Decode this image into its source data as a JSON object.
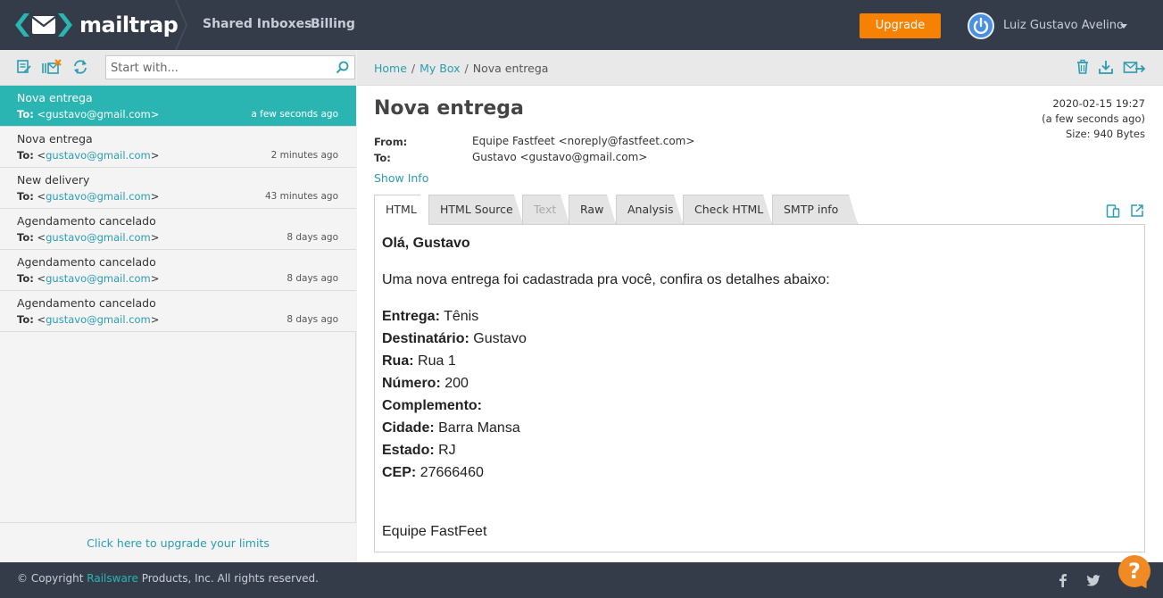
{
  "app": {
    "name": "mailtrap",
    "brand_color": "#2bb5b2",
    "nav_color": "#333c48",
    "accent_color": "#f78103"
  },
  "header": {
    "nav": [
      "Shared Inboxes",
      "Billing"
    ],
    "upgrade_label": "Upgrade",
    "user_name": "Luiz Gustavo Avelino"
  },
  "inbox": {
    "search_placeholder": "Start with...",
    "messages": [
      {
        "subject": "Nova entrega",
        "to_label": "To:",
        "to_email": "gustavo@gmail.com",
        "time": "a few seconds ago",
        "active": true
      },
      {
        "subject": "Nova entrega",
        "to_label": "To:",
        "to_email": "gustavo@gmail.com",
        "time": "2 minutes ago",
        "active": false
      },
      {
        "subject": "New delivery",
        "to_label": "To:",
        "to_email": "gustavo@gmail.com",
        "time": "43 minutes ago",
        "active": false
      },
      {
        "subject": "Agendamento cancelado",
        "to_label": "To:",
        "to_email": "gustavo@gmail.com",
        "time": "8 days ago",
        "active": false
      },
      {
        "subject": "Agendamento cancelado",
        "to_label": "To:",
        "to_email": "gustavo@gmail.com",
        "time": "8 days ago",
        "active": false
      },
      {
        "subject": "Agendamento cancelado",
        "to_label": "To:",
        "to_email": "gustavo@gmail.com",
        "time": "8 days ago",
        "active": false
      }
    ],
    "upgrade_limits_label": "Click here to upgrade your limits"
  },
  "breadcrumb": [
    "Home",
    "My Box",
    "Nova entrega"
  ],
  "message": {
    "subject": "Nova entrega",
    "datetime": "2020-02-15 19:27",
    "relative_time": "(a few seconds ago)",
    "size": "Size: 940 Bytes",
    "from_label": "From:",
    "from_value": "Equipe Fastfeet <noreply@fastfeet.com>",
    "to_label": "To:",
    "to_value": "Gustavo <gustavo@gmail.com>",
    "show_info": "Show Info"
  },
  "tabs": [
    {
      "label": "HTML",
      "state": "active"
    },
    {
      "label": "HTML Source",
      "state": "normal"
    },
    {
      "label": "Text",
      "state": "disabled"
    },
    {
      "label": "Raw",
      "state": "normal"
    },
    {
      "label": "Analysis",
      "state": "normal"
    },
    {
      "label": "Check HTML",
      "state": "normal"
    },
    {
      "label": "SMTP info",
      "state": "normal"
    }
  ],
  "body": {
    "greeting": "Olá, Gustavo",
    "intro": "Uma nova entrega foi cadastrada pra você, confira os detalhes abaixo:",
    "fields": [
      {
        "label": "Entrega:",
        "value": "Tênis"
      },
      {
        "label": "Destinatário:",
        "value": "Gustavo"
      },
      {
        "label": "Rua:",
        "value": "Rua 1"
      },
      {
        "label": "Número:",
        "value": "200"
      },
      {
        "label": "Complemento:",
        "value": ""
      },
      {
        "label": "Cidade:",
        "value": "Barra Mansa"
      },
      {
        "label": "Estado:",
        "value": "RJ"
      },
      {
        "label": "CEP:",
        "value": "27666460"
      }
    ],
    "signature": "Equipe FastFeet"
  },
  "footer": {
    "copyright_prefix": "© Copyright",
    "company_link": "Railsware",
    "copyright_suffix": "Products, Inc. All rights reserved.",
    "help_label": "?"
  }
}
